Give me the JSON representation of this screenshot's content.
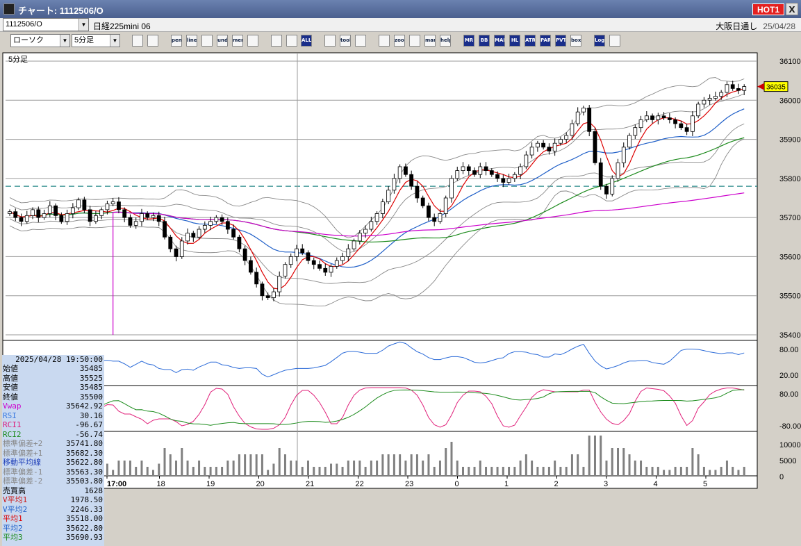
{
  "window": {
    "title": "チャート: 1112506/O",
    "hot_label": "HOT1",
    "close_label": "X"
  },
  "toolbar": {
    "symbol": "1112506/O",
    "instrument_name": "日経225mini 06",
    "chart_type": "ローソク",
    "timeframe": "5分足",
    "exchange": "大阪日通し",
    "date": "25/04/28"
  },
  "toolbar_buttons": [
    "search",
    "window",
    "pen",
    "line",
    "cursor",
    "undo",
    "memo",
    "trash",
    "candle1",
    "candle2",
    "ALL",
    "config",
    "tool",
    "color",
    "export",
    "zoom",
    "indicators",
    "mark",
    "help",
    "MR",
    "BB",
    "MAE",
    "HL",
    "ATR",
    "PAR",
    "PVT",
    "box",
    "Log",
    "window2"
  ],
  "colors": {
    "up": "#ffffff",
    "down": "#000000",
    "ma_short": "#dd0000",
    "ma_mid": "#1f5fc8",
    "ma_long": "#1b8a1b",
    "vwap": "#cc00cc",
    "band": "#888888",
    "rsi": "#2a6ad8",
    "rci1": "#e0207a",
    "rci2": "#1a8a1a",
    "volume": "#808080"
  },
  "chart_data": {
    "type": "candlestick",
    "panel_label": "5分足",
    "last_price": "36035",
    "price_ticks": [
      "36100",
      "36000",
      "35900",
      "35800",
      "35700",
      "35600",
      "35500",
      "35400"
    ],
    "price_range": [
      35400,
      36100
    ],
    "dashed_level": 35780,
    "time_labels": [
      "17:00",
      "18",
      "19",
      "20",
      "21",
      "22",
      "23",
      "0",
      "1",
      "2",
      "3",
      "4",
      "5"
    ],
    "rsi_ticks": [
      "80.00",
      "20.00"
    ],
    "rci_ticks": [
      "80.00",
      "-80.00"
    ],
    "volume_ticks": [
      "10000",
      "5000",
      "0"
    ],
    "closes": [
      35715,
      35700,
      35690,
      35705,
      35720,
      35700,
      35710,
      35730,
      35705,
      35690,
      35710,
      35725,
      35745,
      35720,
      35690,
      35705,
      35720,
      35735,
      35740,
      35720,
      35700,
      35680,
      35690,
      35710,
      35700,
      35705,
      35690,
      35650,
      35620,
      35600,
      35640,
      35660,
      35650,
      35670,
      35680,
      35690,
      35700,
      35690,
      35670,
      35650,
      35620,
      35590,
      35560,
      35530,
      35500,
      35495,
      35510,
      35550,
      35580,
      35600,
      35620,
      35610,
      35590,
      35580,
      35570,
      35560,
      35575,
      35590,
      35600,
      35620,
      35640,
      35660,
      35670,
      35690,
      35710,
      35740,
      35770,
      35800,
      35830,
      35810,
      35780,
      35750,
      35730,
      35700,
      35690,
      35710,
      35750,
      35800,
      35820,
      35830,
      35820,
      35810,
      35830,
      35820,
      35810,
      35800,
      35790,
      35800,
      35810,
      35830,
      35860,
      35880,
      35890,
      35880,
      35870,
      35890,
      35900,
      35910,
      35940,
      35970,
      35980,
      35920,
      35840,
      35780,
      35760,
      35800,
      35840,
      35880,
      35910,
      35930,
      35950,
      35960,
      35950,
      35960,
      35955,
      35950,
      35940,
      35930,
      35920,
      35960,
      35990,
      36000,
      36005,
      36010,
      36020,
      36040,
      36030,
      36025,
      36035
    ]
  },
  "info_panel": {
    "datetime": "2025/04/28 19:50:00",
    "rows": [
      {
        "label": "始値",
        "value": "35485",
        "color": "#000000"
      },
      {
        "label": "高値",
        "value": "35525",
        "color": "#000000"
      },
      {
        "label": "安値",
        "value": "35485",
        "color": "#000000"
      },
      {
        "label": "終値",
        "value": "35500",
        "color": "#000000"
      },
      {
        "label": "Vwap",
        "value": "35642.92",
        "color": "#cc00cc"
      },
      {
        "label": "RSI",
        "value": "30.16",
        "color": "#3a7ae0"
      },
      {
        "label": "RCI1",
        "value": "-96.67",
        "color": "#dd1a7a"
      },
      {
        "label": "RCI2",
        "value": "-56.74",
        "color": "#1a8a1a"
      },
      {
        "label": "標準偏差+2",
        "value": "35741.80",
        "color": "#888888"
      },
      {
        "label": "標準偏差+1",
        "value": "35682.30",
        "color": "#888888"
      },
      {
        "label": "移動平均線",
        "value": "35622.80",
        "color": "#1f3fb8"
      },
      {
        "label": "標準偏差-1",
        "value": "35563.30",
        "color": "#888888"
      },
      {
        "label": "標準偏差-2",
        "value": "35503.80",
        "color": "#888888"
      },
      {
        "label": "売買高",
        "value": "1628",
        "color": "#000000"
      },
      {
        "label": "V平均1",
        "value": "1978.50",
        "color": "#cc1a1a"
      },
      {
        "label": "V平均2",
        "value": "2246.33",
        "color": "#1f5fc8"
      },
      {
        "label": "平均1",
        "value": "35518.00",
        "color": "#dd0000"
      },
      {
        "label": "平均2",
        "value": "35622.80",
        "color": "#1f5fc8"
      },
      {
        "label": "平均3",
        "value": "35690.93",
        "color": "#1b8a1b"
      }
    ]
  }
}
